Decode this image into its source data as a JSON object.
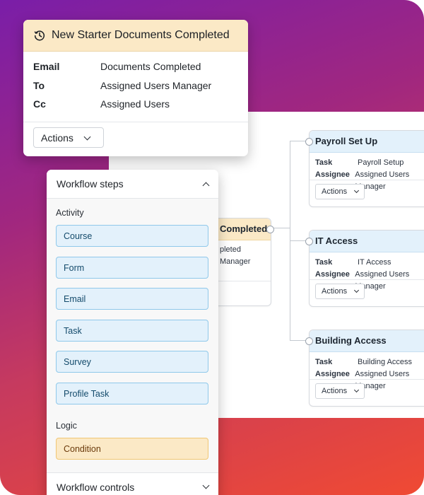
{
  "notification_card": {
    "title": "New Starter Documents Completed",
    "rows": [
      {
        "label": "Email",
        "value": "Documents Completed"
      },
      {
        "label": "To",
        "value": "Assigned Users Manager"
      },
      {
        "label": "Cc",
        "value": "Assigned Users"
      }
    ],
    "actions_label": "Actions",
    "header_color": "#fbe9c6"
  },
  "workflow_panel": {
    "title": "Workflow steps",
    "activity_label": "Activity",
    "activity_steps": [
      "Course",
      "Form",
      "Email",
      "Task",
      "Survey",
      "Profile Task"
    ],
    "logic_label": "Logic",
    "logic_steps": [
      "Condition"
    ],
    "footer_label": "Workflow controls"
  },
  "canvas": {
    "trigger_node": {
      "title_visible": "Completed",
      "row1_visible": "pleted",
      "row2_visible": "Manager"
    },
    "task_nodes": [
      {
        "title": "Payroll Set Up",
        "task_label": "Task",
        "task_value": "Payroll Setup",
        "assignee_label": "Assignee",
        "assignee_value": "Assigned Users Manager",
        "actions_label": "Actions"
      },
      {
        "title": "IT Access",
        "task_label": "Task",
        "task_value": "IT Access",
        "assignee_label": "Assignee",
        "assignee_value": "Assigned Users Manager",
        "actions_label": "Actions"
      },
      {
        "title": "Building Access",
        "task_label": "Task",
        "task_value": "Building Access",
        "assignee_label": "Assignee",
        "assignee_value": "Assigned Users Manager",
        "actions_label": "Actions"
      }
    ]
  },
  "colors": {
    "step_blue_bg": "#e3f1fb",
    "step_blue_border": "#8fc8ea",
    "step_yellow_bg": "#fbe9c6",
    "step_yellow_border": "#f0c774",
    "gradient_start": "#7a1ea8",
    "gradient_end": "#f04a33"
  }
}
